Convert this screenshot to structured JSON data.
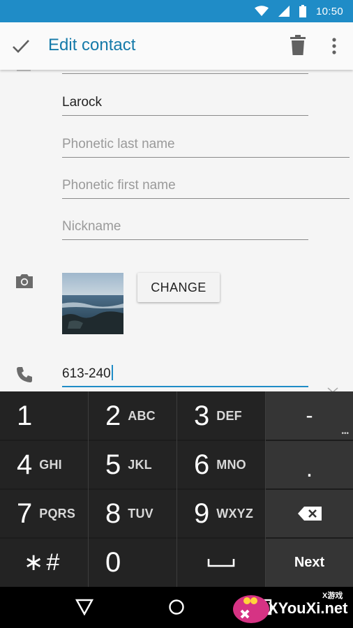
{
  "status_bar": {
    "time": "10:50",
    "icons": [
      "wifi-icon",
      "cell-signal-icon",
      "battery-icon"
    ],
    "bg_color": "#1f8cc7"
  },
  "app_bar": {
    "title": "Edit contact",
    "confirm_icon": "check-icon",
    "delete_icon": "trash-icon",
    "menu_icon": "more-vert-icon",
    "title_color": "#157aa9"
  },
  "form": {
    "last_name": {
      "value": "Larock"
    },
    "phonetic_last_name": {
      "placeholder": "Phonetic last name"
    },
    "phonetic_first_name": {
      "placeholder": "Phonetic first name"
    },
    "nickname": {
      "placeholder": "Nickname"
    },
    "photo": {
      "icon": "camera-icon",
      "change_label": "CHANGE"
    },
    "phone": {
      "icon": "phone-icon",
      "value": "613-240"
    }
  },
  "keypad": {
    "keys": [
      {
        "num": "1",
        "letters": ""
      },
      {
        "num": "2",
        "letters": "ABC"
      },
      {
        "num": "3",
        "letters": "DEF"
      },
      {
        "num": "4",
        "letters": "GHI"
      },
      {
        "num": "5",
        "letters": "JKL"
      },
      {
        "num": "6",
        "letters": "MNO"
      },
      {
        "num": "7",
        "letters": "PQRS"
      },
      {
        "num": "8",
        "letters": "TUV"
      },
      {
        "num": "9",
        "letters": "WXYZ"
      },
      {
        "num": "∗#",
        "letters": ""
      },
      {
        "num": "0",
        "letters": ""
      },
      {
        "num": "␣",
        "letters": ""
      }
    ],
    "side_keys": [
      "-",
      ".",
      "⌫",
      "Next"
    ]
  },
  "nav_bar": {
    "icons": [
      "back-icon",
      "home-icon",
      "recents-icon"
    ]
  },
  "watermark": {
    "text": "XYouXi.net",
    "small": "X游戏"
  }
}
